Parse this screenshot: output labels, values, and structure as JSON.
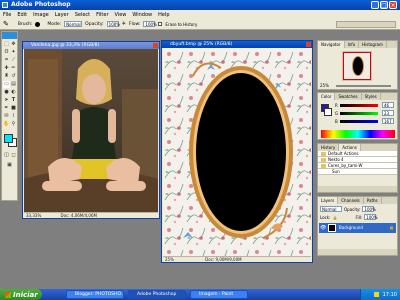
{
  "app": {
    "title": "Adobe Photoshop"
  },
  "menu": [
    "File",
    "Edit",
    "Image",
    "Layer",
    "Select",
    "Filter",
    "View",
    "Window",
    "Help"
  ],
  "options": {
    "brush_label": "Brush:",
    "mode_label": "Mode:",
    "mode_value": "Normal",
    "opacity_label": "Opacity:",
    "opacity_value": "100%",
    "flow_label": "Flow:",
    "flow_value": "100%",
    "airbrush_label": "Erase to History"
  },
  "doc1": {
    "title": "Vanilena.jpg @ 33,3% (RGB/8)",
    "zoom": "33,33%",
    "status": "Doc: 4,06M/4,06M"
  },
  "doc2": {
    "title": "dbyuft.bmp @ 25% (RGB/8)",
    "zoom": "25%",
    "status": "Doc: 9,00M/9,00M"
  },
  "navigator": {
    "tabs": [
      "Navigator",
      "Info",
      "Histogram"
    ],
    "zoom": "25%"
  },
  "color": {
    "tabs": [
      "Color",
      "Swatches",
      "Styles"
    ],
    "channels": [
      {
        "name": "R",
        "value": "46"
      },
      {
        "name": "G",
        "value": "23"
      },
      {
        "name": "B",
        "value": "167"
      }
    ]
  },
  "actions": {
    "tabs": [
      "History",
      "Actions"
    ],
    "items": [
      "Default Actions",
      "Nekto 4",
      "Cores_by_tami-W",
      "Sun"
    ]
  },
  "layers": {
    "tabs": [
      "Layers",
      "Channels",
      "Paths"
    ],
    "mode": "Normal",
    "opacity_label": "Opacity:",
    "opacity": "100%",
    "lock_label": "Lock:",
    "fill_label": "Fill:",
    "fill": "100%",
    "items": [
      "Background"
    ]
  },
  "taskbar": {
    "start": "Iniciar",
    "tasks": [
      "Blogger: PHOTOSHO...",
      "Adobe Photoshop",
      "Imagem - Paint"
    ],
    "clock": "17:10"
  },
  "colors": {
    "accent": "#0842a8",
    "fg_swatch": "#00e5ff",
    "bg_swatch": "#ffffff"
  }
}
